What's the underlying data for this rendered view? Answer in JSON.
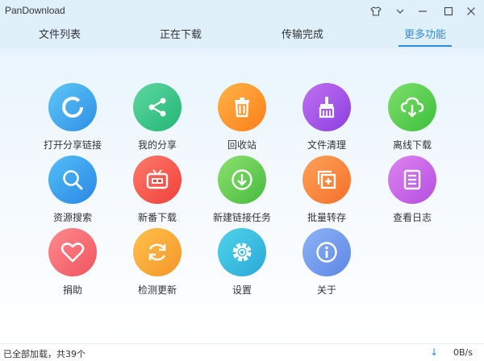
{
  "window": {
    "title": "PanDownload"
  },
  "tabs": [
    {
      "label": "文件列表",
      "active": false
    },
    {
      "label": "正在下载",
      "active": false
    },
    {
      "label": "传输完成",
      "active": false
    },
    {
      "label": "更多功能",
      "active": true
    }
  ],
  "features": [
    {
      "label": "打开分享链接",
      "icon": "open-share-link-icon",
      "color_from": "#5ec8f5",
      "color_to": "#2f8ee8"
    },
    {
      "label": "我的分享",
      "icon": "share-icon",
      "color_from": "#5fd8a0",
      "color_to": "#22b575"
    },
    {
      "label": "回收站",
      "icon": "trash-icon",
      "color_from": "#ffb347",
      "color_to": "#ff7f1a"
    },
    {
      "label": "文件清理",
      "icon": "brush-icon",
      "color_from": "#c171f0",
      "color_to": "#8a3fe0"
    },
    {
      "label": "离线下载",
      "icon": "cloud-download-icon",
      "color_from": "#7ee06a",
      "color_to": "#3cbf3c"
    },
    {
      "label": "资源搜索",
      "icon": "search-icon",
      "color_from": "#52c0f6",
      "color_to": "#2a86e6"
    },
    {
      "label": "新番下载",
      "icon": "tv-icon",
      "color_from": "#ff7a6a",
      "color_to": "#f0403a"
    },
    {
      "label": "新建链接任务",
      "icon": "download-circle-icon",
      "color_from": "#8ee070",
      "color_to": "#44bb3c"
    },
    {
      "label": "批量转存",
      "icon": "batch-transfer-icon",
      "color_from": "#ffa258",
      "color_to": "#f5702a"
    },
    {
      "label": "查看日志",
      "icon": "log-icon",
      "color_from": "#e084f0",
      "color_to": "#b24ee0"
    },
    {
      "label": "捐助",
      "icon": "heart-icon",
      "color_from": "#ff8a8e",
      "color_to": "#f0555e"
    },
    {
      "label": "检测更新",
      "icon": "refresh-icon",
      "color_from": "#ffc14a",
      "color_to": "#f5972a"
    },
    {
      "label": "设置",
      "icon": "gear-icon",
      "color_from": "#4fd4ea",
      "color_to": "#2aa8d8"
    },
    {
      "label": "关于",
      "icon": "info-icon",
      "color_from": "#8fb4f5",
      "color_to": "#5c86e6"
    }
  ],
  "status": {
    "text": "已全部加载，共39个",
    "speed": "0B/s"
  },
  "colors": {
    "accent": "#2f8be0",
    "header_bg": "#dff0fb"
  }
}
